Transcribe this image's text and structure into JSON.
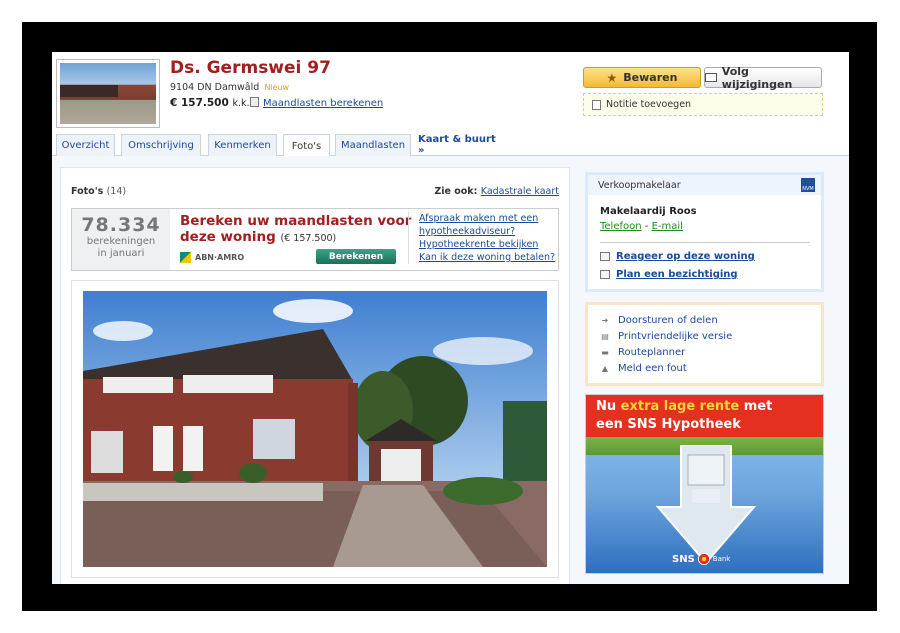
{
  "listing": {
    "title": "Ds. Germswei 97",
    "address": "9104 DN Damwâld",
    "new_badge": "Nieuw",
    "price": "€ 157.500",
    "price_suffix": "k.k.",
    "monthly_link": "Maandlasten berekenen"
  },
  "actions": {
    "save_label": "Bewaren",
    "follow_label": "Volg wijzigingen",
    "note_label": "Notitie toevoegen"
  },
  "tabs": [
    {
      "label": "Overzicht"
    },
    {
      "label": "Omschrijving"
    },
    {
      "label": "Kenmerken"
    },
    {
      "label": "Foto's"
    },
    {
      "label": "Maandlasten"
    },
    {
      "label": "Kaart & buurt »"
    }
  ],
  "photos": {
    "heading": "Foto's",
    "count": "(14)",
    "see_also_label": "Zie ook:",
    "see_also_link": "Kadastrale kaart"
  },
  "calculator": {
    "count": "78.334",
    "count_line1": "berekeningen",
    "count_line2": "in januari",
    "title": "Bereken uw maandlasten voor deze woning",
    "amount": "(€ 157.500)",
    "bank": "ABN·AMRO",
    "button": "Berekenen",
    "links": [
      "Afspraak maken met een hypotheekadviseur?",
      "Hypotheekrente bekijken",
      "Kan ik deze woning betalen?"
    ]
  },
  "agent": {
    "heading": "Verkoopmakelaar",
    "logo_text": "NVM",
    "name": "Makelaardij Roos",
    "phone": "Telefoon",
    "sep": "-",
    "email": "E-mail",
    "respond": "Reageer op deze woning",
    "viewing": "Plan een bezichtiging"
  },
  "tools": [
    "Doorsturen of delen",
    "Printvriendelijke versie",
    "Routeplanner",
    "Meld een fout"
  ],
  "ad": {
    "line1_pre": "Nu",
    "line1_highlight": "extra lage rente",
    "line1_post": "met",
    "line2": "een SNS Hypotheek",
    "logo": "SNS",
    "logo_sub": "Bank"
  }
}
